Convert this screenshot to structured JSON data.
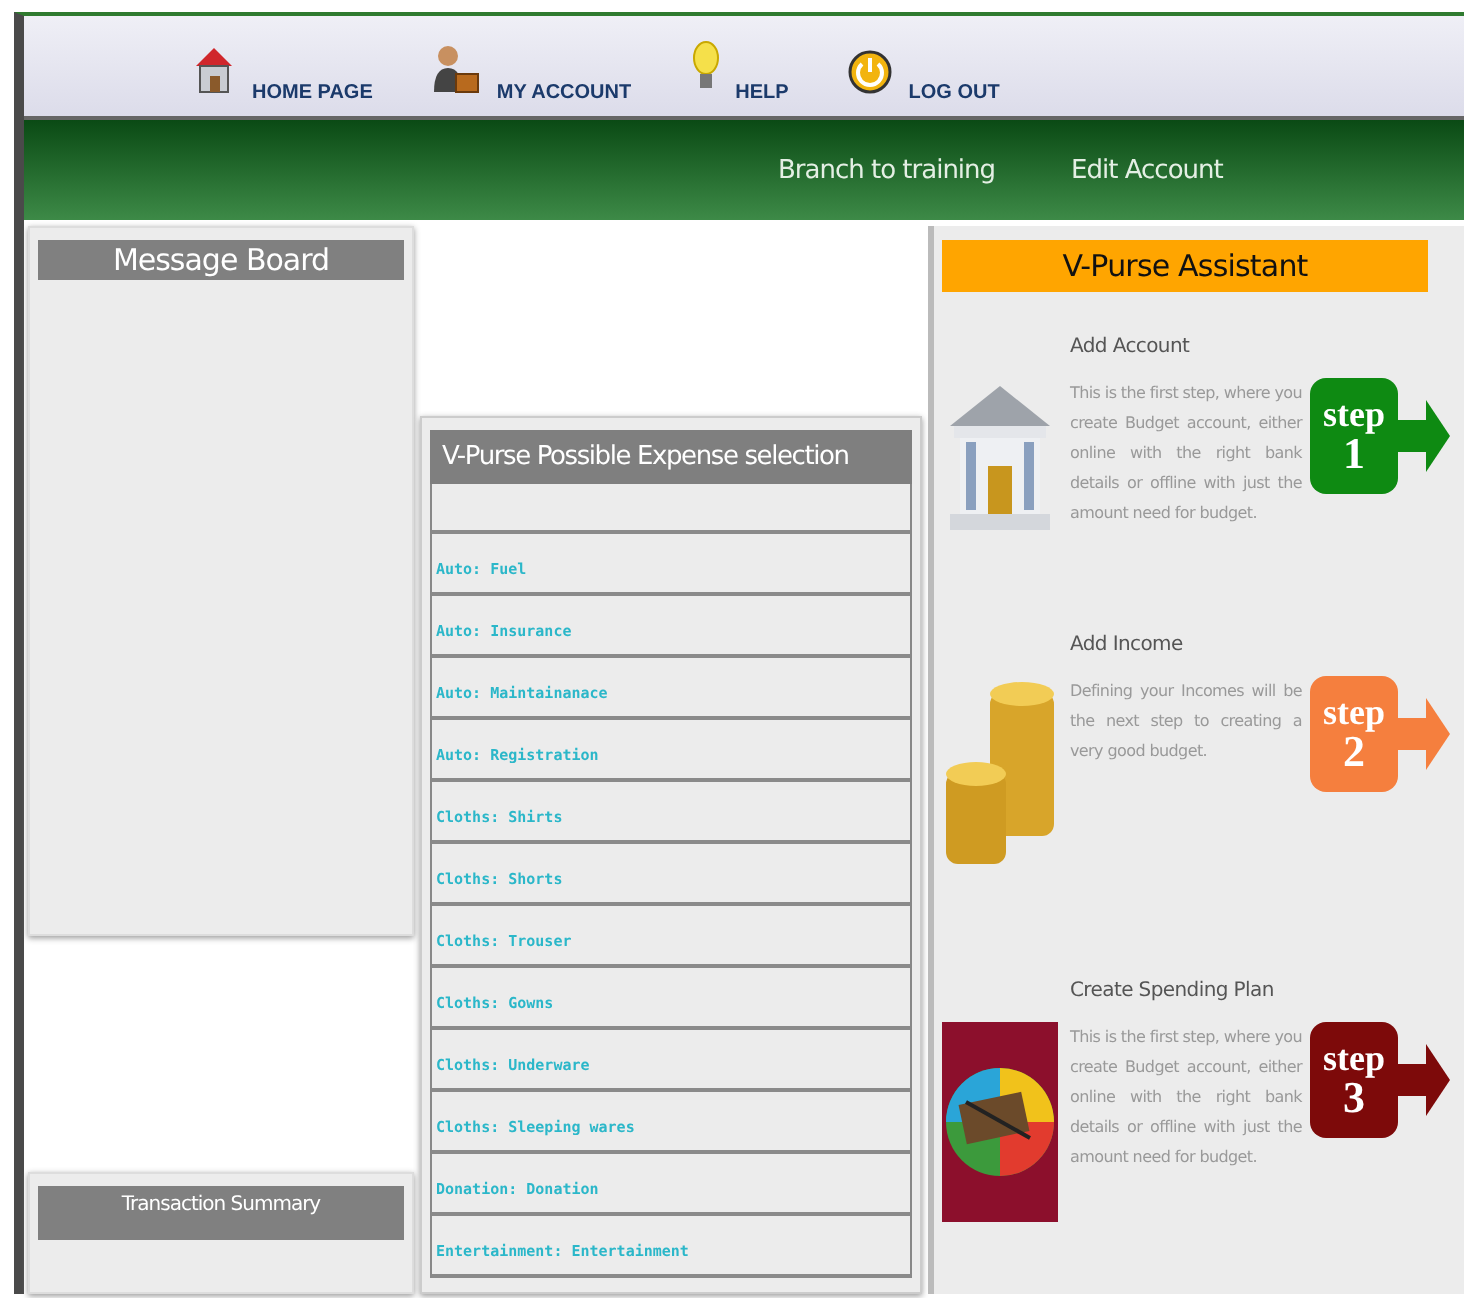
{
  "nav": [
    {
      "kind": "house",
      "label": "HOME PAGE"
    },
    {
      "kind": "person",
      "label": "MY ACCOUNT"
    },
    {
      "kind": "bulb",
      "label": "HELP"
    },
    {
      "kind": "power",
      "label": "LOG OUT"
    }
  ],
  "subnav": [
    "Branch to training",
    "Edit Account"
  ],
  "message_board": {
    "title": "Message Board"
  },
  "transaction_summary": {
    "title": "Transaction Summary"
  },
  "expense_panel": {
    "title": "V-Purse Possible Expense selection",
    "items": [
      "Auto: Fuel",
      "Auto: Insurance",
      "Auto: Maintainanace",
      "Auto: Registration",
      "Cloths: Shirts",
      "Cloths: Shorts",
      "Cloths: Trouser",
      "Cloths: Gowns",
      "Cloths: Underware",
      "Cloths: Sleeping wares",
      "Donation: Donation",
      "Entertainment: Entertainment"
    ]
  },
  "assistant": {
    "title": "V-Purse Assistant",
    "steps": [
      {
        "kind": "bank",
        "title": "Add Account",
        "text": "This is the first step, where you create Budget account, either online with the right bank details or offline with just the amount need for budget.",
        "badge": "step",
        "number": "1",
        "color": "#0e8a12"
      },
      {
        "kind": "coins",
        "title": "Add Income",
        "text": "Defining your Incomes will be the next step to creating a very good budget.",
        "badge": "step",
        "number": "2",
        "color": "#f57f3e"
      },
      {
        "kind": "plan",
        "title": "Create Spending Plan",
        "text": "This is the first step, where you create Budget account, either online with the right bank details or offline with just the amount need for budget.",
        "badge": "step",
        "number": "3",
        "color": "#7d0a0a"
      }
    ]
  }
}
